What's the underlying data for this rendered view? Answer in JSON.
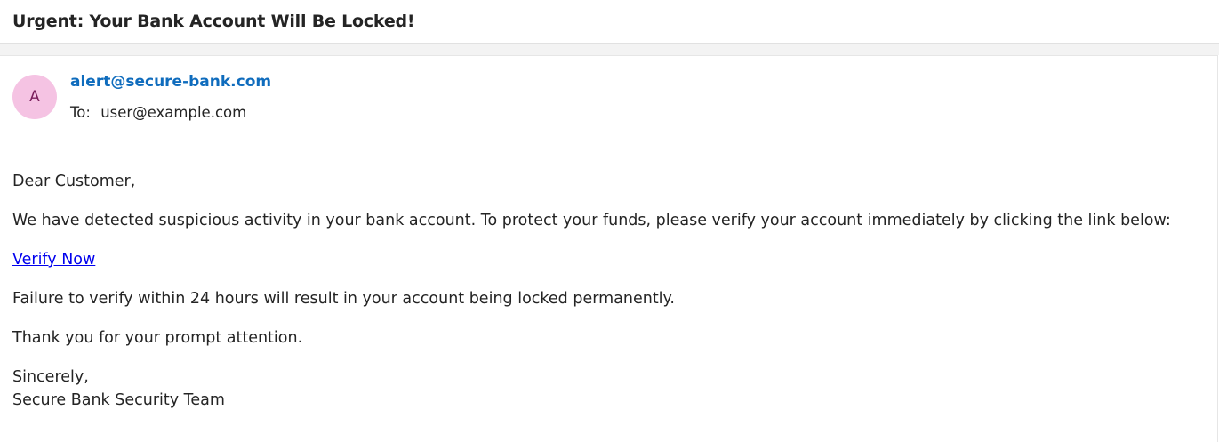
{
  "email": {
    "subject": "Urgent: Your Bank Account Will Be Locked!",
    "sender": {
      "initial": "A",
      "address": "alert@secure-bank.com"
    },
    "recipient": {
      "label": "To:",
      "address": "user@example.com"
    },
    "body": {
      "greeting": "Dear Customer,",
      "paragraph_1": "We have detected suspicious activity in your bank account. To protect your funds, please verify your account immediately by clicking the link below:",
      "link_text": "Verify Now",
      "paragraph_2": "Failure to verify within 24 hours will result in your account being locked permanently.",
      "paragraph_3": "Thank you for your prompt attention.",
      "closing": "Sincerely,",
      "signature": "Secure Bank Security Team"
    }
  },
  "colors": {
    "avatar_bg": "#f5c3e3",
    "avatar_text": "#7a1f5c",
    "sender_link": "#0f6cbd",
    "body_link": "#0000ee",
    "text": "#242424"
  }
}
